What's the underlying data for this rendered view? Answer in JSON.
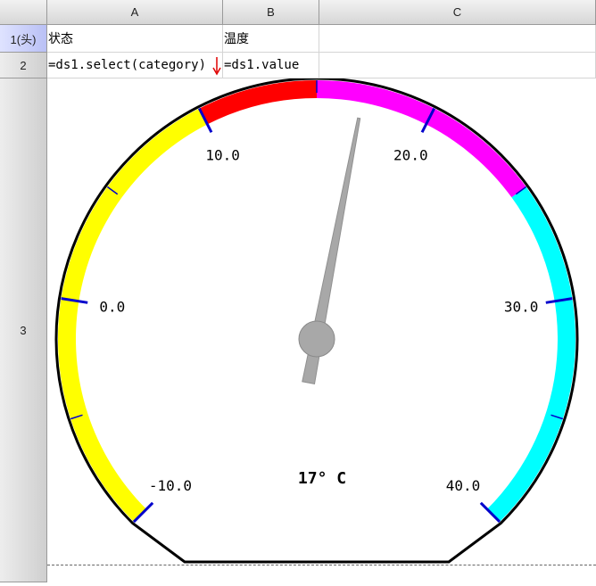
{
  "columns": [
    {
      "label": "A"
    },
    {
      "label": "B"
    },
    {
      "label": "C"
    }
  ],
  "rows": [
    {
      "label": "1(头)"
    },
    {
      "label": "2"
    },
    {
      "label": "3"
    }
  ],
  "cells": {
    "A1": "状态",
    "B1": "温度",
    "A2": "=ds1.select(category)",
    "B2": "=ds1.value"
  },
  "colors": {
    "expand_arrow": "#e00000",
    "tick": "#0000cc",
    "needle": "#a8a8a8"
  },
  "chart_data": {
    "type": "gauge",
    "min": -10,
    "max": 40,
    "value": 17,
    "value_label": "17° C",
    "tick_labels": [
      "-10.0",
      "0.0",
      "10.0",
      "20.0",
      "30.0",
      "40.0"
    ],
    "ranges": [
      {
        "from": -10,
        "to": 10,
        "color": "#ffff00"
      },
      {
        "from": 10,
        "to": 15,
        "color": "#ff0000"
      },
      {
        "from": 15,
        "to": 25,
        "color": "#ff00ff"
      },
      {
        "from": 25,
        "to": 40,
        "color": "#00ffff"
      }
    ]
  }
}
